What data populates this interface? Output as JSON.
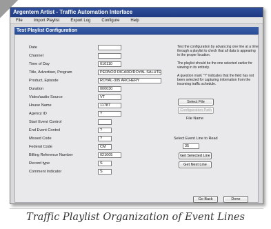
{
  "window": {
    "title": "Argentem Artist  -  Traffic Automation Interface"
  },
  "menu": {
    "items": [
      "File",
      "Import Playlist",
      "Export Log",
      "Configure",
      "Help"
    ]
  },
  "panel": {
    "title": "Test Playlist Configuration"
  },
  "fields": [
    {
      "label": "Date",
      "value": ""
    },
    {
      "label": "Channel",
      "value": ""
    },
    {
      "label": "Time of Day",
      "value": "010110"
    },
    {
      "label": "Title, Advertiser, Program",
      "value": "PERNOD RICARD/ROYAL SALUTE"
    },
    {
      "label": "Product, Episode",
      "value": "ROYAL-305 ARCHERY"
    },
    {
      "label": "Duration",
      "value": "000030"
    },
    {
      "label": "Video/audio Source",
      "value": "VT"
    },
    {
      "label": "House Name",
      "value": "11787"
    },
    {
      "label": "Agency ID",
      "value": "?"
    },
    {
      "label": "Start Event Control",
      "value": ""
    },
    {
      "label": "End Event Control",
      "value": "?"
    },
    {
      "label": "Missed Code",
      "value": "?"
    },
    {
      "label": "Federal Code",
      "value": "CM"
    },
    {
      "label": "Billing Reference Number",
      "value": "021005"
    },
    {
      "label": "Record type",
      "value": "S"
    },
    {
      "label": "Comment Indicator",
      "value": "S"
    }
  ],
  "info": {
    "para1": "Test the configuration by advancing one line at a time through a playlist to check that all data is appearing in the proper location.",
    "para2": "The playlist should be the one selected earlier for viewing in its entirety.",
    "para3": "A question mark \"?\" indicates that the field has not been selected for capturing information from the incoming traffic schedule."
  },
  "buttons": {
    "select_file": "Select File",
    "configuration_path": "Configuration Path",
    "file_name_label": "File Name",
    "select_event_line_label": "Select Event Line to Read",
    "event_line_value": "35",
    "get_selected_line": "Get Selected Line",
    "get_next_line": "Get Next Line",
    "go_back": "Go Back",
    "done": "Done"
  },
  "caption": "Traffic Playlist Organization of Event Lines"
}
